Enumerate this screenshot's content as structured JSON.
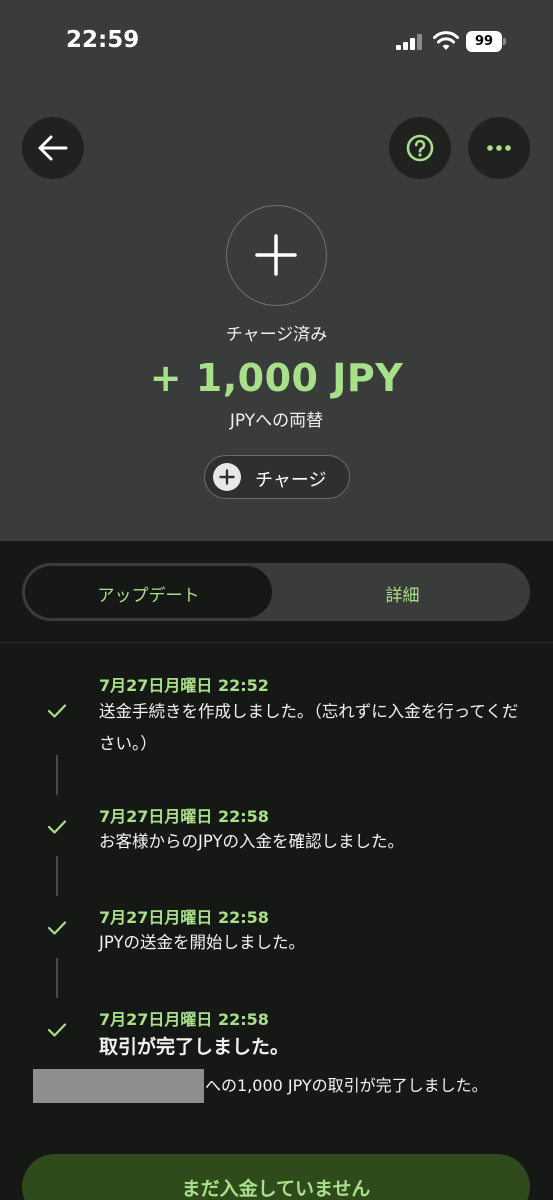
{
  "status_bar": {
    "time": "22:59",
    "battery": "99"
  },
  "header": {
    "back_icon": "arrow-left-icon",
    "help_icon": "question-circle-icon",
    "more_icon": "more-dots-icon",
    "main_icon": "plus-icon",
    "status_label": "チャージ済み",
    "amount": "+ 1,000 JPY",
    "conversion": "JPYへの両替",
    "charge_button": "チャージ"
  },
  "tabs": [
    {
      "label": "アップデート",
      "active": true
    },
    {
      "label": "詳細",
      "active": false
    }
  ],
  "events": [
    {
      "date": "7月27日月曜日 22:52",
      "text": "送金手続きを作成しました。（忘れずに入金を行ってください。）"
    },
    {
      "date": "7月27日月曜日 22:58",
      "text": "お客様からのJPYの入金を確認しました。"
    },
    {
      "date": "7月27日月曜日 22:58",
      "text": "JPYの送金を開始しました。"
    },
    {
      "date": "7月27日月曜日 22:58",
      "text": "取引が完了しました。",
      "detail": "への1,000 JPYの取引が完了しました。"
    }
  ],
  "bottom_button": "まだ入金していません",
  "colors": {
    "accent": "#a8e08a",
    "header_bg": "#3a3b3b",
    "page_bg": "#161816",
    "button_bg": "#2f4a1b"
  }
}
